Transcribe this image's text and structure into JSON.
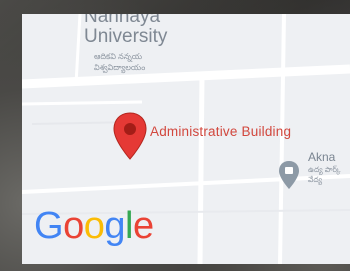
{
  "map": {
    "university_name": "University",
    "university_name_partial": "Nannaya",
    "university_local_line1": "ఆదికవి నన్నయ",
    "university_local_line2": "విశ్వవిద్యాలయం",
    "marker_label": "Administrative Building",
    "poi_label": "Akna",
    "poi_local_line1": "ఉద్య పార్క్",
    "poi_local_line2": "వేద్య",
    "logo_text": "Google"
  },
  "colors": {
    "map_background": "#eef0f3",
    "road": "#ffffff",
    "marker": "#e53935",
    "marker_label": "#d2473d",
    "poi_marker": "#8d9aa6"
  },
  "icons": {
    "marker": "map-pin-icon",
    "poi": "place-pin-icon"
  }
}
